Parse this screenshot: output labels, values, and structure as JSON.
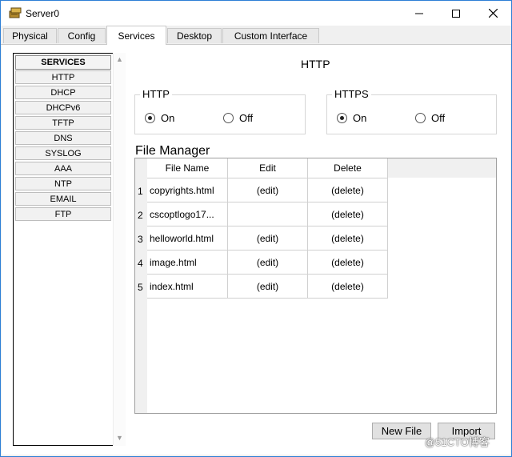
{
  "window": {
    "title": "Server0"
  },
  "tabs": [
    "Physical",
    "Config",
    "Services",
    "Desktop",
    "Custom Interface"
  ],
  "services": {
    "header": "SERVICES",
    "items": [
      "HTTP",
      "DHCP",
      "DHCPv6",
      "TFTP",
      "DNS",
      "SYSLOG",
      "AAA",
      "NTP",
      "EMAIL",
      "FTP"
    ]
  },
  "http_page": {
    "title": "HTTP",
    "http_group": {
      "legend": "HTTP",
      "on": "On",
      "off": "Off",
      "selected": "On"
    },
    "https_group": {
      "legend": "HTTPS",
      "on": "On",
      "off": "Off",
      "selected": "On"
    }
  },
  "file_manager": {
    "title": "File Manager",
    "columns": [
      "File Name",
      "Edit",
      "Delete"
    ],
    "rows": [
      {
        "num": "1",
        "name": "copyrights.html",
        "edit": "(edit)",
        "delete": "(delete)"
      },
      {
        "num": "2",
        "name": "cscoptlogo17...",
        "edit": "",
        "delete": "(delete)"
      },
      {
        "num": "3",
        "name": "helloworld.html",
        "edit": "(edit)",
        "delete": "(delete)"
      },
      {
        "num": "4",
        "name": "image.html",
        "edit": "(edit)",
        "delete": "(delete)"
      },
      {
        "num": "5",
        "name": "index.html",
        "edit": "(edit)",
        "delete": "(delete)"
      }
    ]
  },
  "buttons": {
    "new_file": "New File",
    "import": "Import"
  },
  "watermark": "@51CTO博客"
}
